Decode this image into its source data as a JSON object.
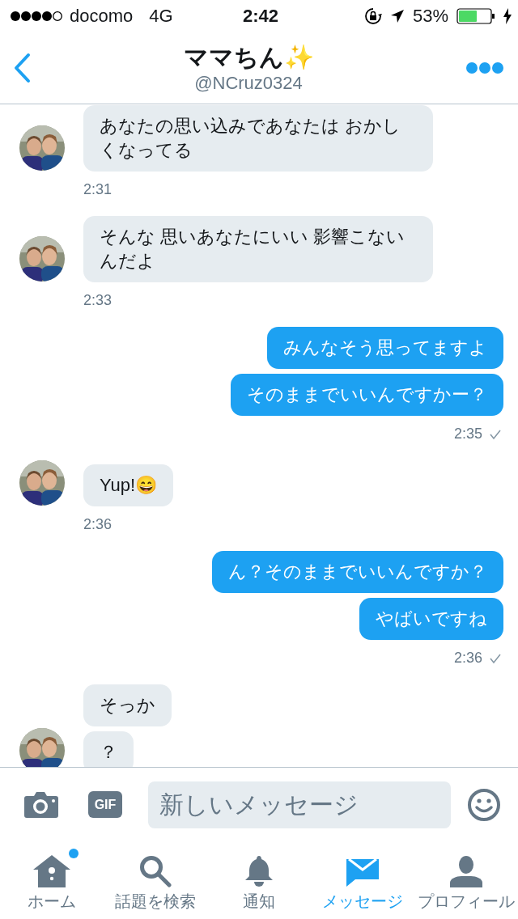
{
  "status_bar": {
    "carrier": "docomo",
    "network": "4G",
    "time": "2:42",
    "battery": "53%"
  },
  "header": {
    "title": "ママちん✨",
    "handle": "@NCruz0324"
  },
  "messages": [
    {
      "kind": "incoming",
      "bubbles": [
        "あなたの思い込みであなたは おかしくなってる"
      ],
      "time": "2:31"
    },
    {
      "kind": "incoming",
      "bubbles": [
        "そんな 思いあなたにいい 影響こないんだよ"
      ],
      "time": "2:33"
    },
    {
      "kind": "outgoing",
      "bubbles": [
        "みんなそう思ってますよ",
        "そのままでいいんですかー？"
      ],
      "time": "2:35",
      "read": true
    },
    {
      "kind": "incoming",
      "bubbles": [
        "Yup!😄"
      ],
      "time": "2:36"
    },
    {
      "kind": "outgoing",
      "bubbles": [
        "ん？そのままでいいんですか？",
        "やばいですね"
      ],
      "time": "2:36",
      "read": true
    },
    {
      "kind": "incoming",
      "bubbles": [
        "そっか",
        "？"
      ]
    }
  ],
  "composer": {
    "gif": "GIF",
    "placeholder": "新しいメッセージ"
  },
  "tabs": [
    {
      "kind": "home",
      "label": "ホーム",
      "selected": false,
      "badge": true
    },
    {
      "kind": "search",
      "label": "話題を検索",
      "selected": false,
      "badge": false
    },
    {
      "kind": "bell",
      "label": "通知",
      "selected": false,
      "badge": false
    },
    {
      "kind": "mail",
      "label": "メッセージ",
      "selected": true,
      "badge": false
    },
    {
      "kind": "person",
      "label": "プロフィール",
      "selected": false,
      "badge": false
    }
  ]
}
